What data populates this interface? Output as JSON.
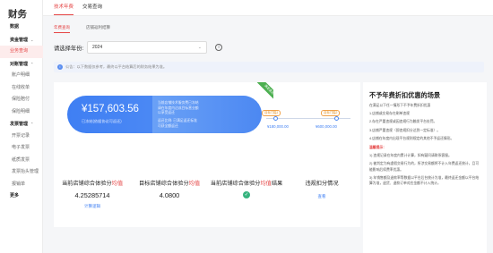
{
  "app": {
    "title": "财务"
  },
  "sidebar": {
    "items": [
      {
        "label": "数据",
        "type": "group"
      },
      {
        "label": "资金管理",
        "type": "group",
        "caret": "⌄"
      },
      {
        "label": "业务查询",
        "type": "active"
      },
      {
        "label": "对账管理",
        "type": "group",
        "caret": "⌃"
      },
      {
        "label": "账户明细",
        "type": "sub"
      },
      {
        "label": "在线收单",
        "type": "sub"
      },
      {
        "label": "保险赔付",
        "type": "sub"
      },
      {
        "label": "保险明细",
        "type": "sub"
      },
      {
        "label": "发票管理",
        "type": "group",
        "caret": "⌃"
      },
      {
        "label": "开票记录",
        "type": "sub"
      },
      {
        "label": "电子发票",
        "type": "sub"
      },
      {
        "label": "纸质发票",
        "type": "sub"
      },
      {
        "label": "发票抬头管理",
        "type": "sub"
      },
      {
        "label": "报销单",
        "type": "sub"
      },
      {
        "label": "更多",
        "type": "group"
      }
    ]
  },
  "tabs": {
    "tab1": "技术年费",
    "tab2": "交易查询"
  },
  "subtabs": {
    "tab1": "年费查询",
    "tab2": "店铺返利结算"
  },
  "year": {
    "label": "请选择年份:",
    "value": "2024",
    "chevron": "⌄",
    "info_icon": "i"
  },
  "notice": {
    "icon": "i",
    "text": "公告：以下数据仅参考，最终以平台结算后的财务结果为准。"
  },
  "card": {
    "amount": "¥157,603.56",
    "amount_sub": "已冻结(依据协议可返还)",
    "pill_text_lines": [
      "当前店铺技术服务费已冻结",
      "请在年度内达成目标营业额",
      "以享受返还"
    ],
    "pill_text_lines2": [
      "返还比例: 已满足返还标准",
      "可获全额返还"
    ],
    "ribbon": "满足返还",
    "tag_left": "目标门槛1",
    "tag_right": "目标门槛2",
    "gauge_left": "¥180,000.00",
    "gauge_right": "¥600,000.00",
    "stats": [
      {
        "label_pre": "当前店铺综合体验分",
        "label_hl": "均值",
        "value": "4.25285714",
        "link": "计算逻辑"
      },
      {
        "label_pre": "目标店铺综合体验分",
        "label_hl": "均值",
        "value": "4.0800"
      },
      {
        "label_pre": "当前店铺综合体验分",
        "label_hl": "均值",
        "label_post": "结果",
        "check": "✓"
      },
      {
        "label_pre": "违规扣分情况",
        "label_hl": "",
        "link": "查看"
      }
    ]
  },
  "rpanel": {
    "title": "不予年费折扣优惠的场景",
    "intro": "在满足以下任一情形下不予年费折扣优惠",
    "lines": [
      "1.店铺或交易存在刷单违规",
      "2.存在严重违规或因违规行为触发平台处罚。",
      "3.店铺严重违规（即违规扣分达到一定标准）。",
      "4.店铺在年度内出现平台规则规定的其他不予返还情形。"
    ],
    "warn": "温馨提示：",
    "notes": [
      "1) 违规记录在年度内累计计算，如有疑问请联系客服。",
      "2) 被判定为有虚假交易行为的，所涉交易额将不计入年费返还统计，且可能影响后续费率优惠。",
      "3) 年销售额及退款率等数据以平台后台统计为准，最终返还金额以平台结算为准，退货、退款订单对应金额不计入统计。"
    ]
  },
  "colors": {
    "accent": "#e54545",
    "blue": "#3f7ff3",
    "green": "#4caf50"
  }
}
